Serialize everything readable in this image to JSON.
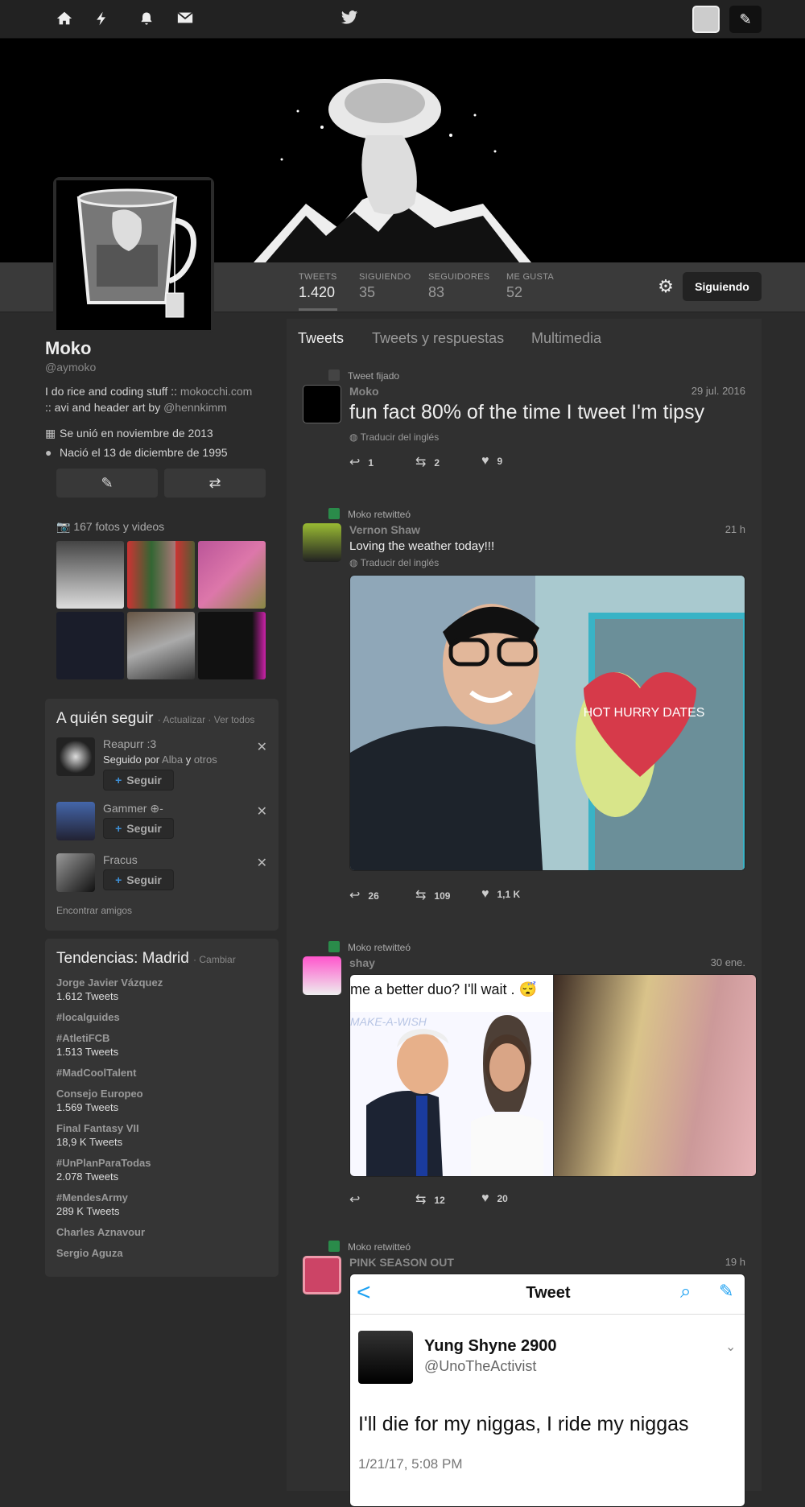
{
  "nav": {
    "home_icon": "home-icon",
    "moments_icon": "lightning-icon",
    "notifications_icon": "bell-icon",
    "messages_icon": "envelope-icon",
    "logo_icon": "twitter-bird-icon",
    "compose_icon": "compose-icon"
  },
  "stats": [
    {
      "label": "TWEETS",
      "value": "1.420"
    },
    {
      "label": "SIGUIENDO",
      "value": "35"
    },
    {
      "label": "SEGUIDORES",
      "value": "83"
    },
    {
      "label": "ME GUSTA",
      "value": "52"
    }
  ],
  "follow_button": "Siguiendo",
  "profile": {
    "name": "Moko",
    "handle": "@aymoko",
    "bio_line1": "I do rice and coding stuff :: ",
    "bio_link1": "mokocchi.com",
    "bio_line2": ":: avi and header art by ",
    "bio_link2": "@hennkimm",
    "joined": "Se unió en noviembre de 2013",
    "born": "Nació el 13 de diciembre de 1995",
    "photos": "167 fotos y videos"
  },
  "who_to_follow": {
    "title": "A quién seguir",
    "actions": "· Actualizar · Ver todos",
    "follow_label": "Seguir",
    "users": [
      {
        "name": "Reapurr :3",
        "followed_by": "Seguido por",
        "followed_names": "Alba",
        "and": "y",
        "others": "otros"
      },
      {
        "name": "Gammer ⊕-"
      },
      {
        "name": "Fracus"
      }
    ],
    "find_friends": "Encontrar amigos"
  },
  "trends": {
    "title": "Tendencias: Madrid",
    "change": "· Cambiar",
    "items": [
      {
        "topic": "Jorge Javier Vázquez",
        "count": "1.612 Tweets"
      },
      {
        "topic": "#localguides",
        "count": ""
      },
      {
        "topic": "#AtletiFCB",
        "count": "1.513 Tweets"
      },
      {
        "topic": "#MadCoolTalent",
        "count": ""
      },
      {
        "topic": "Consejo Europeo",
        "count": "1.569 Tweets"
      },
      {
        "topic": "Final Fantasy VII",
        "count": "18,9 K Tweets"
      },
      {
        "topic": "#UnPlanParaTodas",
        "count": "2.078 Tweets"
      },
      {
        "topic": "#MendesArmy",
        "count": "289 K Tweets"
      },
      {
        "topic": "Charles Aznavour",
        "count": ""
      },
      {
        "topic": "Sergio Aguza",
        "count": ""
      }
    ]
  },
  "tabs": [
    "Tweets",
    "Tweets y respuestas",
    "Multimedia"
  ],
  "tweets": [
    {
      "context": "Tweet fijado",
      "name": "Moko",
      "time": "29 jul. 2016",
      "text": "fun fact 80% of the time I tweet I'm tipsy",
      "translate": "Traducir del inglés",
      "replies": "1",
      "retweets": "2",
      "likes": "9"
    },
    {
      "context": "Moko retwitteó",
      "name": "Vernon Shaw",
      "time": "21 h",
      "text": "Loving the weather today!!!",
      "translate": "Traducir del inglés",
      "replies": "26",
      "retweets": "109",
      "likes": "1,1 K",
      "sign_text": "HOT HURRY DATES"
    },
    {
      "context": "Moko retwitteó",
      "name": "shay",
      "time": "30 ene.",
      "caption": "me a better duo? I'll wait . 😴",
      "replies": "",
      "retweets": "12",
      "likes": "20",
      "backdrop": "MAKE-A-WISH"
    },
    {
      "context": "Moko retwitteó",
      "name": "PINK SEASON OUT",
      "time": "19 h",
      "embed": {
        "back": "<",
        "header": "Tweet",
        "name": "Yung Shyne 2900",
        "handle": "@UnoTheActivist",
        "text": "I'll die for my niggas, I ride my niggas",
        "date": "1/21/17, 5:08 PM"
      }
    }
  ],
  "colors": {
    "bg": "#2b2b2b",
    "panel": "#353535",
    "link_blue": "#3d8fd6",
    "retweet_green": "#2a8b4a"
  }
}
